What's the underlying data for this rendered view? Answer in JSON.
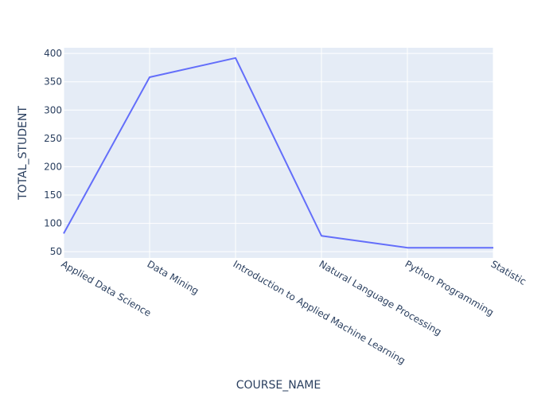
{
  "chart_data": {
    "type": "line",
    "categories": [
      "Applied Data Science",
      "Data Mining",
      "Introduction to Applied Machine Learning",
      "Natural Language Processing",
      "Python Programming",
      "Statistic"
    ],
    "series": [
      {
        "values": [
          82,
          358,
          392,
          78,
          57,
          57
        ]
      }
    ],
    "xlabel": "COURSE_NAME",
    "ylabel": "TOTAL_STUDENT",
    "ylim": [
      39,
      410
    ],
    "yticks": [
      50,
      100,
      150,
      200,
      250,
      300,
      350,
      400
    ],
    "grid": true,
    "colors": {
      "plot_bg": "#e5ecf6",
      "grid": "#ffffff",
      "line": "#636efa",
      "text": "#2a3f5f"
    }
  }
}
